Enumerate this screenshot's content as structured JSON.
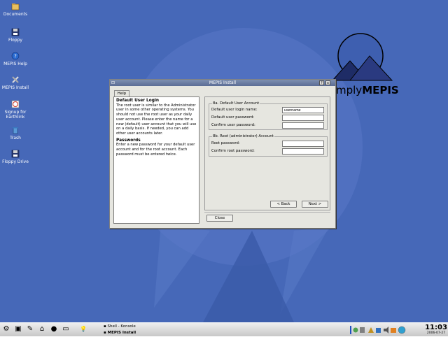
{
  "desktop": {
    "icons": [
      {
        "label": "Documents",
        "icon": "documents-icon"
      },
      {
        "label": "Floppy",
        "icon": "floppy-icon"
      },
      {
        "label": "MEPIS Help",
        "icon": "help-icon"
      },
      {
        "label": "MEPIS Install",
        "icon": "install-icon"
      },
      {
        "label": "Signup for Earthlink",
        "icon": "earthlink-icon"
      },
      {
        "label": "Trash",
        "icon": "trash-icon"
      },
      {
        "label": "Floppy Drive",
        "icon": "floppy-drive-icon"
      }
    ],
    "logo_prefix": "mply",
    "logo_brand": "MEPIS"
  },
  "dialog": {
    "title": "MEPIS Install",
    "help_button": "?",
    "close_button": "x",
    "tab_label": "Help",
    "help": {
      "heading1": "Default User Login",
      "text1": "The root user is similar to the Administrator user in some other operating systems. You should not use the root user as your daily user account. Please enter the name for a new (default) user account that you will use on a daily basis. If needed, you can add other user accounts later.",
      "heading2": "Passwords",
      "text2": "Enter a new password for your default user account and for the root account. Each password must be entered twice."
    },
    "group_a": {
      "legend": "8a. Default User Account",
      "login_label": "Default user login name:",
      "login_value": "username",
      "password_label": "Default user password:",
      "confirm_label": "Confirm user password:"
    },
    "group_b": {
      "legend": "8b. Root (administrator) Account",
      "root_label": "Root password:",
      "confirm_label": "Confirm root password:"
    },
    "back_button": "< Back",
    "next_button": "Next >",
    "close_dialog_button": "Close"
  },
  "taskbar": {
    "tasks": [
      "Shell - Konsole",
      "MEPIS Install"
    ],
    "time": "11:03",
    "date": "2006-07-27",
    "colors": {
      "accent": "#4668b8"
    }
  }
}
